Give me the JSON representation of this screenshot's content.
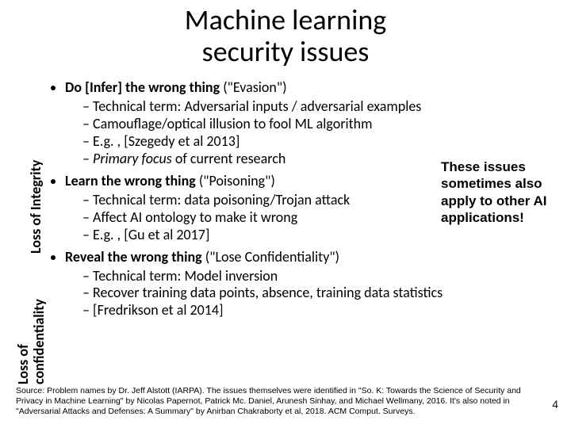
{
  "title": {
    "line1": "Machine learning",
    "line2": "security issues"
  },
  "side_labels": {
    "integrity": "Loss of Integrity",
    "conf_line1": "Loss of",
    "conf_line2": "confidentiality"
  },
  "bullets": [
    {
      "heading_bold": "Do [Infer] the wrong thing ",
      "heading_rest": "(\"Evasion\")",
      "subs": [
        "Technical term: Adversarial inputs / adversarial examples",
        "Camouflage/optical illusion to fool ML algorithm",
        "E.g. , [Szegedy et al 2013]",
        ""
      ],
      "subs_prefix": {
        "3": ""
      },
      "subs_em": {
        "3": "Primary focus"
      },
      "subs_suffix": {
        "3": " of current research"
      }
    },
    {
      "heading_bold": "Learn the wrong thing ",
      "heading_rest": "(\"Poisoning\")",
      "subs": [
        "Technical term: data poisoning/Trojan attack",
        "Affect AI ontology to make it wrong",
        "E.g. , [Gu et al 2017]"
      ]
    },
    {
      "heading_bold": "Reveal the wrong thing ",
      "heading_rest": "(\"Lose Confidentiality\")",
      "subs": [
        "Technical term: Model inversion",
        "Recover training data points, absence, training data statistics",
        "[Fredrikson et al 2014]"
      ]
    }
  ],
  "callout": "These issues sometimes also apply to other AI applications!",
  "source": "Source: Problem names by Dr. Jeff Alstott (IARPA). The issues themselves were identified in \"So. K: Towards the Science of Security and Privacy in Machine Learning\" by Nicolas Papernot, Patrick Mc. Daniel, Arunesh Sinhay, and Michael Wellmany, 2016. It's also noted in \"Adversarial Attacks and Defenses: A Summary\" by Anirban Chakraborty et al, 2018. ACM Comput. Surveys.",
  "page_number": "4"
}
